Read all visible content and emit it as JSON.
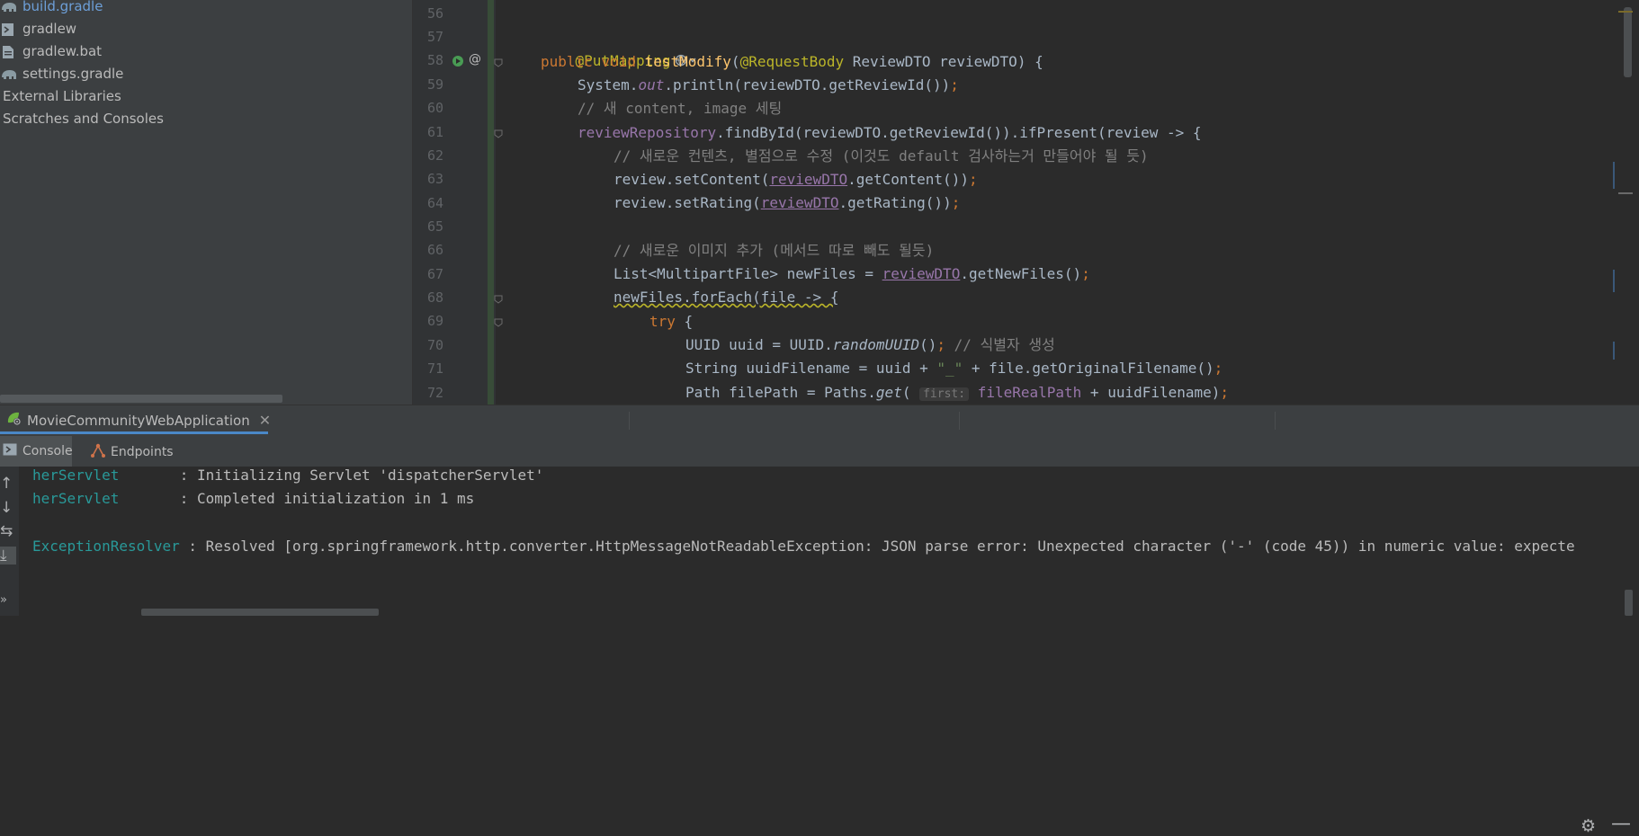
{
  "project_tree": {
    "items": [
      {
        "label": "build.gradle",
        "icon": "gradle-elephant-icon",
        "selected": true
      },
      {
        "label": "gradlew",
        "icon": "script-file-icon"
      },
      {
        "label": "gradlew.bat",
        "icon": "bat-file-icon"
      },
      {
        "label": "settings.gradle",
        "icon": "gradle-elephant-icon"
      },
      {
        "label": "External Libraries",
        "icon": ""
      },
      {
        "label": "Scratches and Consoles",
        "icon": ""
      }
    ]
  },
  "editor": {
    "line_numbers": [
      "56",
      "57",
      "58",
      "59",
      "60",
      "61",
      "62",
      "63",
      "64",
      "65",
      "66",
      "67",
      "68",
      "69",
      "70",
      "71",
      "72"
    ],
    "code": {
      "l57_annotation": "@PutMapping",
      "l58_kw": "public void ",
      "l58_fn": "testModify",
      "l58_open": "(",
      "l58_ann": "@RequestBody",
      "l58_rest": " ReviewDTO reviewDTO) {",
      "l59_a": "System.",
      "l59_out": "out",
      "l59_b": ".println(reviewDTO.getReviewId())",
      "l59_semi": ";",
      "l60": "// 새 content, image 세팅",
      "l61_fld": "reviewRepository",
      "l61_rest": ".findById(reviewDTO.getReviewId()).ifPresent(review -> {",
      "l62": "// 새로운 컨텐츠, 별점으로 수정 (이것도 default 검사하는거 만들어야 될 듯)",
      "l63_a": "review.setContent(",
      "l63_var": "reviewDTO",
      "l63_b": ".getContent())",
      "l63_semi": ";",
      "l64_a": "review.setRating(",
      "l64_var": "reviewDTO",
      "l64_b": ".getRating())",
      "l64_semi": ";",
      "l66": "// 새로운 이미지 추가 (메서드 따로 빼도 될듯)",
      "l67_a": "List<MultipartFile> newFiles = ",
      "l67_var": "reviewDTO",
      "l67_b": ".getNewFiles()",
      "l67_semi": ";",
      "l68": "newFiles.forEach(file -> {",
      "l69_kw": "try",
      "l69_rest": " {",
      "l70_a": "UUID uuid = UUID.",
      "l70_it": "randomUUID",
      "l70_b": "()",
      "l70_semi": "; ",
      "l70_cm": "// 식별자 생성",
      "l71_a": "String uuidFilename = uuid + ",
      "l71_str": "\"_\"",
      "l71_b": " + file.getOriginalFilename()",
      "l71_semi": ";",
      "l72_a": "Path filePath = Paths.",
      "l72_it": "get",
      "l72_open": "( ",
      "l72_hint": "first:",
      "l72_fld": " fileRealPath",
      "l72_b": " + uuidFilename)",
      "l72_semi": ";"
    }
  },
  "run_panel": {
    "tab_label": "MovieCommunityWebApplication",
    "sub_tabs": {
      "console": "Console",
      "endpoints": "Endpoints"
    }
  },
  "console": {
    "lines": [
      {
        "logger": "herServlet       ",
        "message": ": Initializing Servlet 'dispatcherServlet'"
      },
      {
        "logger": "herServlet       ",
        "message": ": Completed initialization in 1 ms"
      },
      {
        "logger": "ExceptionResolver",
        "message": " : Resolved [org.springframework.http.converter.HttpMessageNotReadableException: JSON parse error: Unexpected character ('-' (code 45)) in numeric value: expecte"
      }
    ]
  },
  "colors": {
    "keyword": "#cc7832",
    "function": "#ffc66d",
    "annotation": "#bbb529",
    "comment": "#808080",
    "string": "#6a8759",
    "field": "#9876aa",
    "logger": "#299999",
    "selection_accent": "#4a88c7"
  }
}
